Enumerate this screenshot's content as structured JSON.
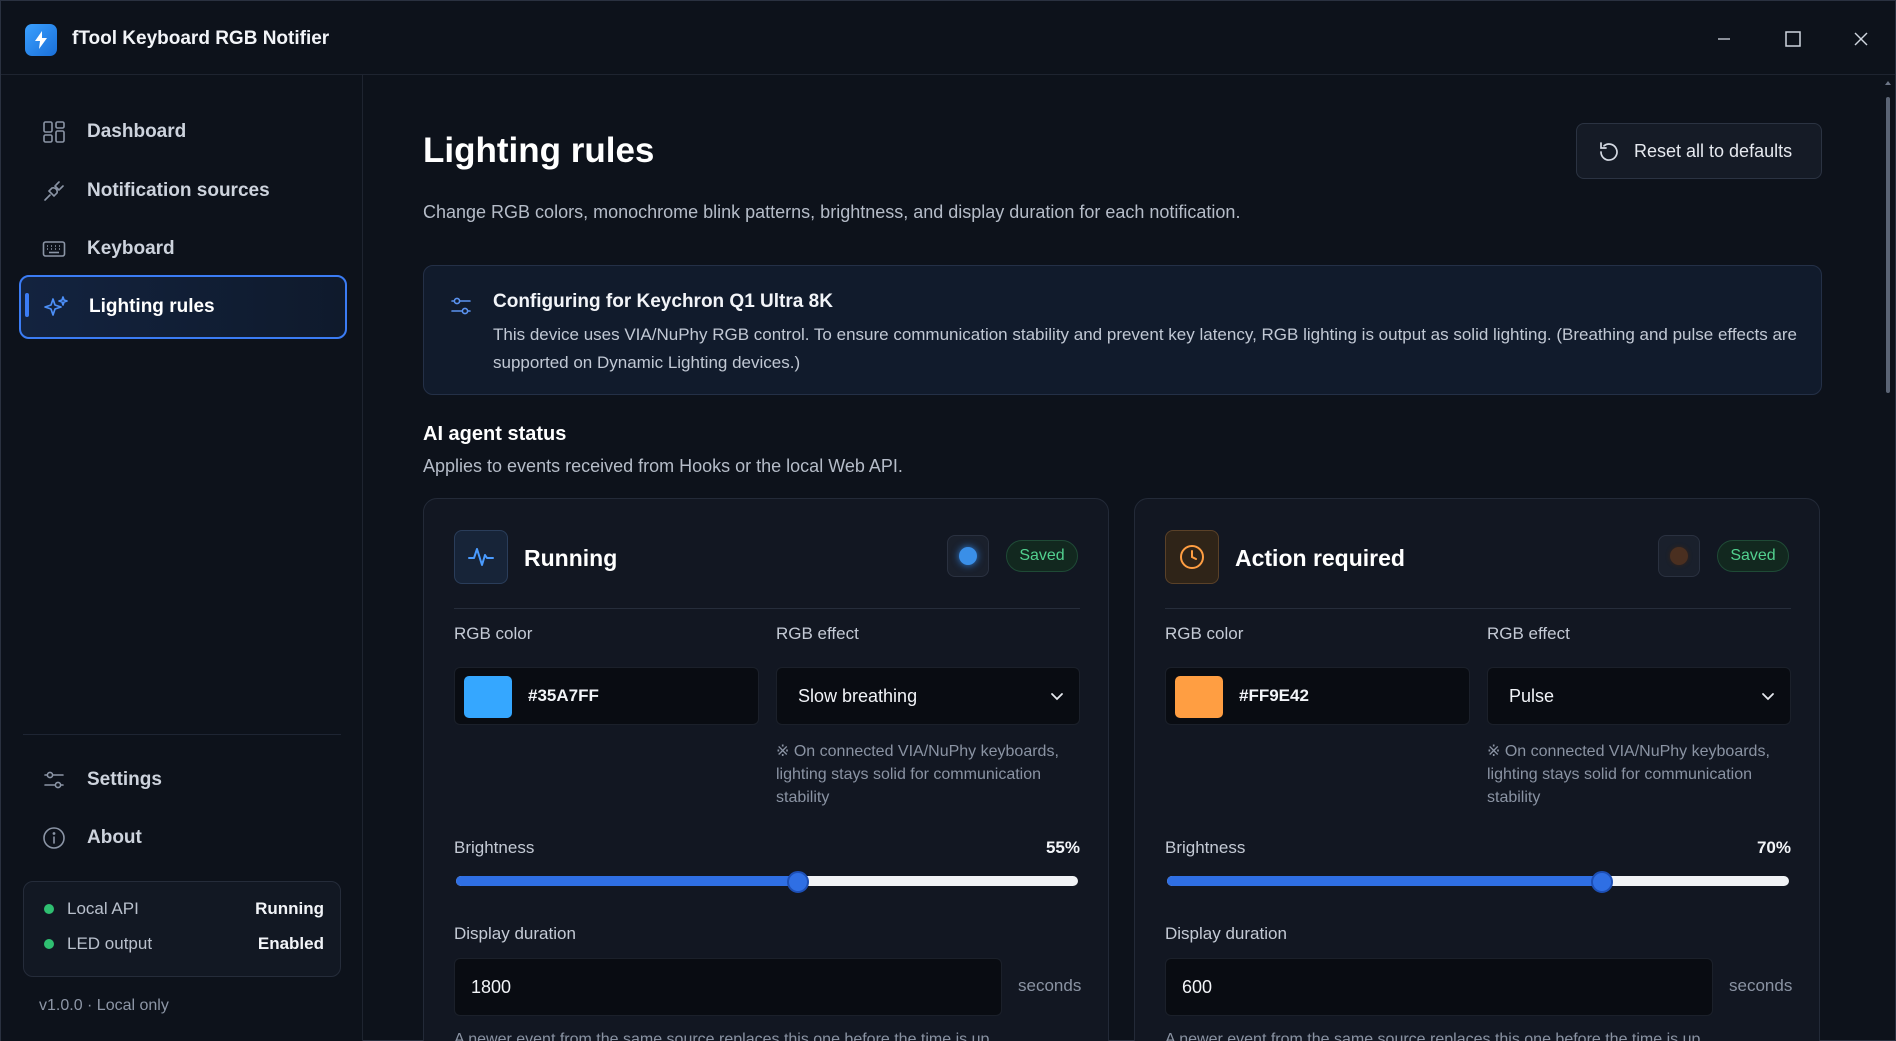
{
  "app": {
    "title": "fTool Keyboard RGB Notifier"
  },
  "sidebar": {
    "items": [
      {
        "label": "Dashboard",
        "icon": "dashboard-icon"
      },
      {
        "label": "Notification sources",
        "icon": "plug-icon"
      },
      {
        "label": "Keyboard",
        "icon": "keyboard-icon"
      },
      {
        "label": "Lighting rules",
        "icon": "sparkles-icon",
        "active": true
      }
    ],
    "bottom_items": [
      {
        "label": "Settings",
        "icon": "sliders-icon"
      },
      {
        "label": "About",
        "icon": "info-icon"
      }
    ],
    "status": [
      {
        "label": "Local API",
        "value": "Running"
      },
      {
        "label": "LED output",
        "value": "Enabled"
      }
    ],
    "version": "v1.0.0 · Local only"
  },
  "main": {
    "title": "Lighting rules",
    "reset_label": "Reset all to defaults",
    "subtitle": "Change RGB colors, monochrome blink patterns, brightness, and display duration for each notification.",
    "info": {
      "title": "Configuring for Keychron Q1 Ultra 8K",
      "text": "This device uses VIA/NuPhy RGB control. To ensure communication stability and prevent key latency, RGB lighting is output as solid lighting. (Breathing and pulse effects are supported on Dynamic Lighting devices.)"
    },
    "section": {
      "title": "AI agent status",
      "subtitle": "Applies to events received from Hooks or the local Web API."
    },
    "cards": [
      {
        "title": "Running",
        "icon": "activity-icon",
        "badge": "Saved",
        "rgb_color_label": "RGB color",
        "rgb_color": "#35A7FF",
        "rgb_effect_label": "RGB effect",
        "rgb_effect": "Slow breathing",
        "effect_note": "※ On connected VIA/NuPhy keyboards, lighting stays solid for communication stability",
        "brightness_label": "Brightness",
        "brightness_text": "55%",
        "brightness": 55,
        "duration_label": "Display duration",
        "duration": "1800",
        "duration_unit": "seconds",
        "duration_note": "A newer event from the same source replaces this one before the time is up"
      },
      {
        "title": "Action required",
        "icon": "clock-icon",
        "badge": "Saved",
        "rgb_color_label": "RGB color",
        "rgb_color": "#FF9E42",
        "rgb_effect_label": "RGB effect",
        "rgb_effect": "Pulse",
        "effect_note": "※ On connected VIA/NuPhy keyboards, lighting stays solid for communication stability",
        "brightness_label": "Brightness",
        "brightness_text": "70%",
        "brightness": 70,
        "duration_label": "Display duration",
        "duration": "600",
        "duration_unit": "seconds",
        "duration_note": "A newer event from the same source replaces this one before the time is up"
      }
    ]
  },
  "colors": {
    "accent": "#3B7CF4",
    "success": "#2FBF71"
  }
}
